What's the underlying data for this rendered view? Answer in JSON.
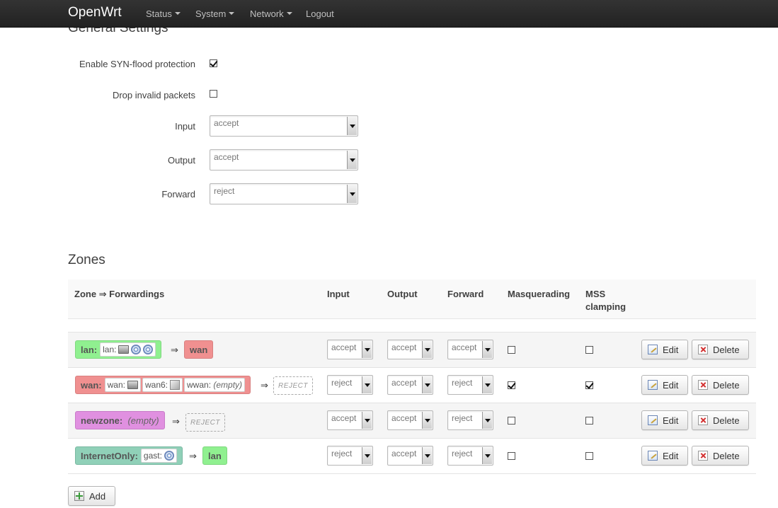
{
  "nav": {
    "brand": "OpenWrt",
    "items": [
      {
        "label": "Status",
        "dropdown": true
      },
      {
        "label": "System",
        "dropdown": true
      },
      {
        "label": "Network",
        "dropdown": true
      },
      {
        "label": "Logout",
        "dropdown": false
      }
    ]
  },
  "general": {
    "title": "General Settings",
    "syn_flood": {
      "label": "Enable SYN-flood protection",
      "checked": true
    },
    "drop_invalid": {
      "label": "Drop invalid packets",
      "checked": false
    },
    "input": {
      "label": "Input",
      "value": "accept"
    },
    "output": {
      "label": "Output",
      "value": "accept"
    },
    "forward": {
      "label": "Forward",
      "value": "reject"
    }
  },
  "zones": {
    "title": "Zones",
    "headers": {
      "zone": "Zone ⇒ Forwardings",
      "input": "Input",
      "output": "Output",
      "forward": "Forward",
      "masq": "Masquerading",
      "mss1": "MSS",
      "mss2": "clamping"
    },
    "arrow": "⇒",
    "rows": [
      {
        "name": "lan:",
        "color": "#90f090",
        "ifaces": [
          {
            "label": "lan:",
            "icons": [
              "network-icon",
              "wifi-icon",
              "wifi-icon"
            ]
          }
        ],
        "dest": {
          "label": "wan",
          "color": "#f09090"
        },
        "input": "accept",
        "output": "accept",
        "forward": "accept",
        "masq": false,
        "mss": false
      },
      {
        "name": "wan:",
        "color": "#f09090",
        "ifaces": [
          {
            "label": "wan:",
            "icons": [
              "network-icon"
            ]
          },
          {
            "label": "wan6:",
            "icons": [
              "tunnel-icon"
            ]
          },
          {
            "label": "wwan:",
            "empty": "(empty)"
          }
        ],
        "dest": {
          "label": "REJECT"
        },
        "input": "reject",
        "output": "accept",
        "forward": "reject",
        "masq": true,
        "mss": true
      },
      {
        "name": "newzone:",
        "empty": "(empty)",
        "color": "#e090e0",
        "dest": {
          "label": "REJECT"
        },
        "input": "accept",
        "output": "accept",
        "forward": "reject",
        "masq": false,
        "mss": false
      },
      {
        "name": "InternetOnly:",
        "color": "#90d0b8",
        "ifaces": [
          {
            "label": "gast:",
            "icons": [
              "wifi-icon"
            ]
          }
        ],
        "dest": {
          "label": "lan",
          "color": "#90f090"
        },
        "input": "reject",
        "output": "accept",
        "forward": "reject",
        "masq": false,
        "mss": false
      }
    ],
    "edit_label": "Edit",
    "delete_label": "Delete",
    "add_label": "Add"
  }
}
